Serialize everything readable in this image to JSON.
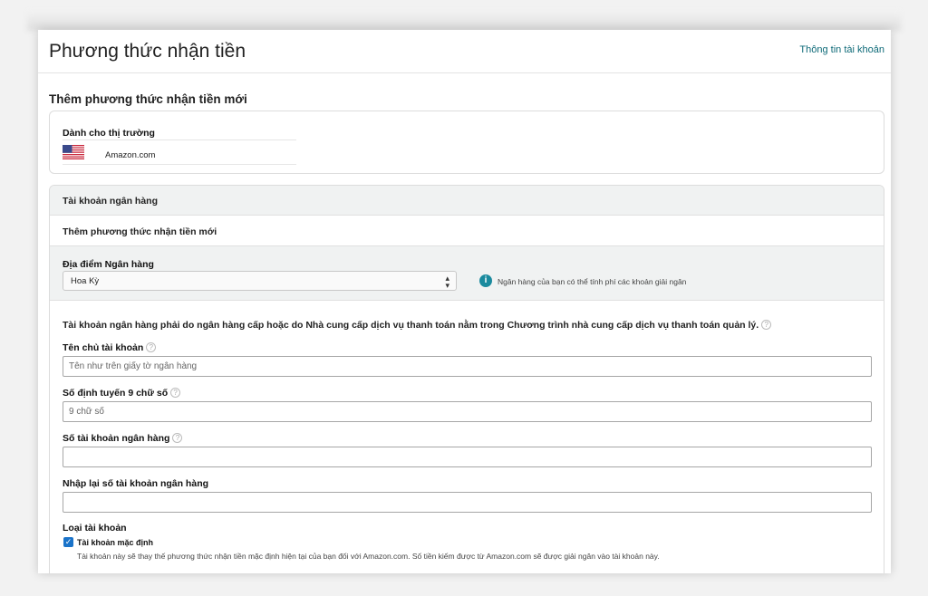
{
  "header": {
    "title": "Phương thức nhận tiền",
    "account_link": "Thông tin tài khoản"
  },
  "section_title": "Thêm phương thức nhận tiền mới",
  "marketplace": {
    "label": "Dành cho thị trường",
    "flag_icon": "us-flag-icon",
    "name": "Amazon.com"
  },
  "bank": {
    "header": "Tài khoản ngân hàng",
    "add_method": "Thêm phương thức nhận tiền mới",
    "location_label": "Địa điểm Ngân hàng",
    "location_value": "Hoa Kỳ",
    "info_text": "Ngân hàng của bạn có thể tính phí các khoản giải ngân",
    "requirement": "Tài khoản ngân hàng phải do ngân hàng cấp hoặc do Nhà cung cấp dịch vụ thanh toán nằm trong Chương trình nhà cung cấp dịch vụ thanh toán quản lý.",
    "fields": [
      {
        "label": "Tên chủ tài khoản",
        "placeholder": "Tên như trên giấy tờ ngân hàng",
        "value": ""
      },
      {
        "label": "Số định tuyến 9 chữ số",
        "placeholder": "9 chữ số",
        "value": ""
      },
      {
        "label": "Số tài khoản ngân hàng",
        "placeholder": "",
        "value": ""
      },
      {
        "label": "Nhập lại số tài khoản ngân hàng",
        "placeholder": "",
        "value": ""
      }
    ],
    "account_type": {
      "label": "Loại tài khoản",
      "default_label": "Tài khoản mặc định",
      "default_checked": true,
      "default_desc": "Tài khoản này sẽ thay thế phương thức nhận tiền mặc định hiện tại của bạn đối với Amazon.com. Số tiền kiếm được từ Amazon.com sẽ được giải ngân vào tài khoản này."
    }
  },
  "colors": {
    "link": "#0e6a78",
    "info_icon": "#1a8a9e",
    "checkbox": "#1a73c9",
    "panel_gray": "#f0f2f2"
  }
}
